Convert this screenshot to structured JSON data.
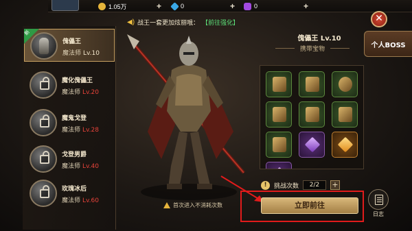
{
  "resources": [
    {
      "name": "gold",
      "icon": "coin-icon",
      "color": "#e6b53a",
      "value": "1.05万"
    },
    {
      "name": "diamond",
      "icon": "diamond-icon",
      "color": "#3aa8e6",
      "value": "0"
    },
    {
      "name": "gem",
      "icon": "purple-gem-icon",
      "color": "#a24ae0",
      "value": "0"
    }
  ],
  "notice": {
    "prefix": "",
    "text": "战王一套更加炫丽哦：",
    "link": "【前往强化】"
  },
  "side_tab": "个人BOSS",
  "bosses": [
    {
      "name": "傀儡王",
      "class": "魔法师",
      "level": "Lv.10",
      "selected": true,
      "locked": false,
      "new": true
    },
    {
      "name": "魔化傀儡王",
      "class": "魔法师",
      "level": "Lv.20",
      "selected": false,
      "locked": true,
      "new": false
    },
    {
      "name": "魔鬼戈登",
      "class": "魔法师",
      "level": "Lv.28",
      "selected": false,
      "locked": true,
      "new": false
    },
    {
      "name": "戈登男爵",
      "class": "魔法师",
      "level": "Lv.40",
      "selected": false,
      "locked": true,
      "new": false
    },
    {
      "name": "玫瑰冰后",
      "class": "魔法师",
      "level": "Lv.60",
      "selected": false,
      "locked": true,
      "new": false
    }
  ],
  "new_badge": "新",
  "detail": {
    "title": "傀儡王 Lv.10",
    "carry_title": "携带宝物",
    "loot": [
      {
        "icon": "bracer-icon",
        "rarity": "green"
      },
      {
        "icon": "boots-icon",
        "rarity": "green"
      },
      {
        "icon": "shield-icon",
        "rarity": "green"
      },
      {
        "icon": "helmet-icon",
        "rarity": "green"
      },
      {
        "icon": "armor-icon",
        "rarity": "green"
      },
      {
        "icon": "necklace-icon",
        "rarity": "green"
      },
      {
        "icon": "chestplate-icon",
        "rarity": "green"
      },
      {
        "icon": "purple-crystal-icon",
        "rarity": "purple"
      },
      {
        "icon": "orange-crystal-icon",
        "rarity": "orange"
      }
    ],
    "challenge_label": "挑战次数",
    "challenge_value": "2/2",
    "go_button": "立即前往",
    "first_note": "首次进入不消耗次数",
    "log_label": "日志"
  }
}
